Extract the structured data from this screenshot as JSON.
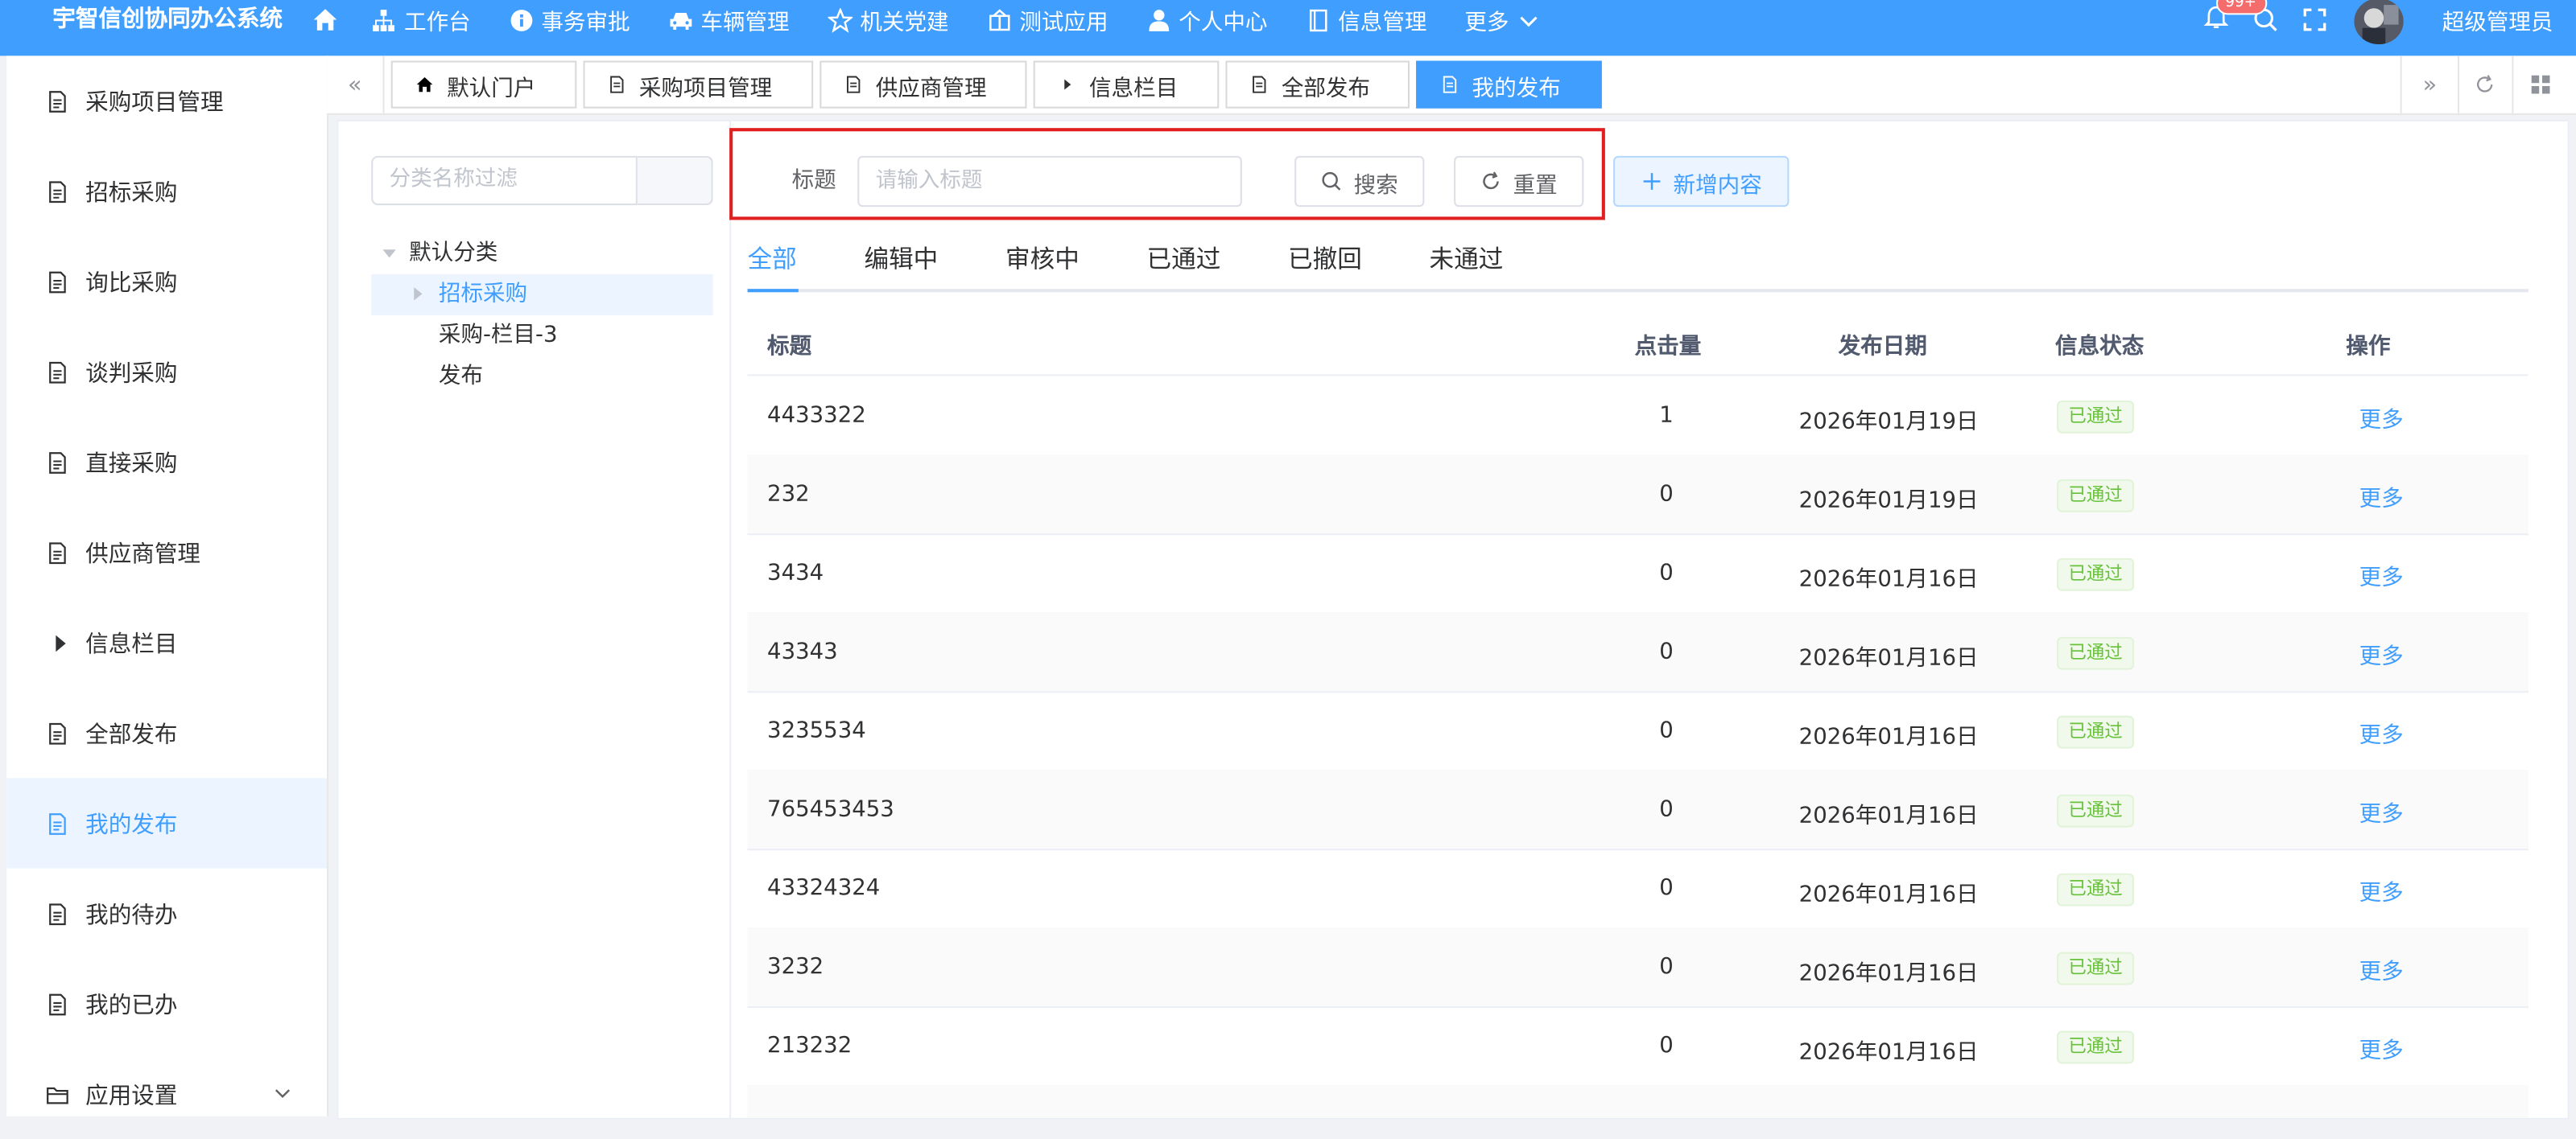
{
  "app": {
    "title": "宇智信创协同办公系统"
  },
  "topnav": [
    {
      "label": "工作台",
      "icon": "sitemap-icon"
    },
    {
      "label": "事务审批",
      "icon": "info-circle-icon"
    },
    {
      "label": "车辆管理",
      "icon": "car-icon"
    },
    {
      "label": "机关党建",
      "icon": "star-icon"
    },
    {
      "label": "测试应用",
      "icon": "app-icon"
    },
    {
      "label": "个人中心",
      "icon": "user-icon"
    },
    {
      "label": "信息管理",
      "icon": "book-icon"
    },
    {
      "label": "更多",
      "icon": "chevron-down-icon"
    }
  ],
  "header": {
    "notify_badge": "99+",
    "user_name": "超级管理员"
  },
  "sidebar": {
    "items": [
      {
        "label": "采购项目管理"
      },
      {
        "label": "招标采购"
      },
      {
        "label": "询比采购"
      },
      {
        "label": "谈判采购"
      },
      {
        "label": "直接采购"
      },
      {
        "label": "供应商管理"
      },
      {
        "label": "信息栏目"
      },
      {
        "label": "全部发布"
      },
      {
        "label": "我的发布"
      },
      {
        "label": "我的待办"
      },
      {
        "label": "我的已办"
      },
      {
        "label": "应用设置"
      }
    ]
  },
  "tags": [
    {
      "label": "默认门户"
    },
    {
      "label": "采购项目管理"
    },
    {
      "label": "供应商管理"
    },
    {
      "label": "信息栏目"
    },
    {
      "label": "全部发布"
    },
    {
      "label": "我的发布"
    }
  ],
  "tree": {
    "filter_placeholder": "分类名称过滤",
    "nodes": [
      {
        "label": "默认分类"
      },
      {
        "label": "招标采购"
      },
      {
        "label": "采购-栏目-3"
      },
      {
        "label": "发布"
      }
    ]
  },
  "search": {
    "title_label": "标题",
    "title_placeholder": "请输入标题",
    "search_label": "搜索",
    "reset_label": "重置",
    "add_label": "新增内容"
  },
  "tabs": [
    {
      "label": "全部"
    },
    {
      "label": "编辑中"
    },
    {
      "label": "审核中"
    },
    {
      "label": "已通过"
    },
    {
      "label": "已撤回"
    },
    {
      "label": "未通过"
    }
  ],
  "table": {
    "headers": {
      "title": "标题",
      "clicks": "点击量",
      "date": "发布日期",
      "status": "信息状态",
      "ops": "操作"
    },
    "rows": [
      {
        "title": "4433322",
        "clicks": "1",
        "date": "2026年01月19日",
        "status": "已通过",
        "op": "更多"
      },
      {
        "title": "232",
        "clicks": "0",
        "date": "2026年01月19日",
        "status": "已通过",
        "op": "更多"
      },
      {
        "title": "3434",
        "clicks": "0",
        "date": "2026年01月16日",
        "status": "已通过",
        "op": "更多"
      },
      {
        "title": "43343",
        "clicks": "0",
        "date": "2026年01月16日",
        "status": "已通过",
        "op": "更多"
      },
      {
        "title": "3235534",
        "clicks": "0",
        "date": "2026年01月16日",
        "status": "已通过",
        "op": "更多"
      },
      {
        "title": "765453453",
        "clicks": "0",
        "date": "2026年01月16日",
        "status": "已通过",
        "op": "更多"
      },
      {
        "title": "43324324",
        "clicks": "0",
        "date": "2026年01月16日",
        "status": "已通过",
        "op": "更多"
      },
      {
        "title": "3232",
        "clicks": "0",
        "date": "2026年01月16日",
        "status": "已通过",
        "op": "更多"
      },
      {
        "title": "213232",
        "clicks": "0",
        "date": "2026年01月16日",
        "status": "已通过",
        "op": "更多"
      }
    ]
  },
  "colors": {
    "primary": "#409eff",
    "success": "#67c23a",
    "highlight_border": "#e02020"
  }
}
